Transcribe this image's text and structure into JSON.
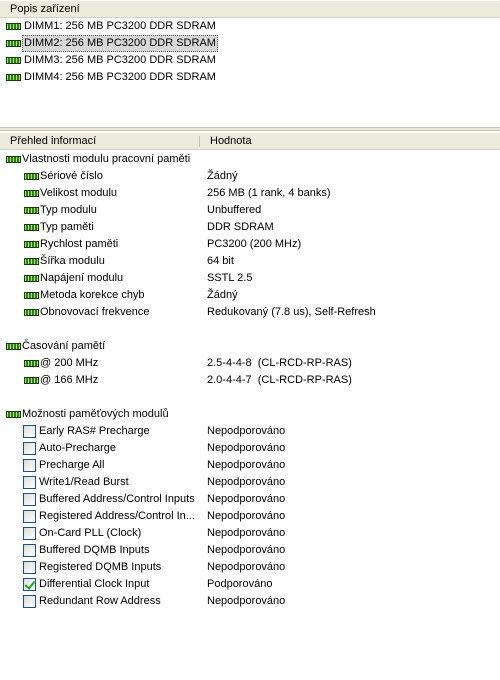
{
  "device_pane": {
    "header": "Popis zařízení",
    "items": [
      {
        "label": "DIMM1: 256 MB PC3200 DDR SDRAM",
        "selected": false
      },
      {
        "label": "DIMM2: 256 MB PC3200 DDR SDRAM",
        "selected": true
      },
      {
        "label": "DIMM3: 256 MB PC3200 DDR SDRAM",
        "selected": false
      },
      {
        "label": "DIMM4: 256 MB PC3200 DDR SDRAM",
        "selected": false
      }
    ]
  },
  "info_pane": {
    "col_field": "Přehled informací",
    "col_value": "Hodnota",
    "module_props": {
      "title": "Vlastnosti modulu pracovní paměti",
      "items": [
        {
          "name": "Sériové číslo",
          "value": "Žádný"
        },
        {
          "name": "Velikost modulu",
          "value": "256 MB (1 rank, 4 banks)"
        },
        {
          "name": "Typ modulu",
          "value": "Unbuffered"
        },
        {
          "name": "Typ paměti",
          "value": "DDR SDRAM"
        },
        {
          "name": "Rychlost paměti",
          "value": "PC3200 (200 MHz)"
        },
        {
          "name": "Šířka modulu",
          "value": "64 bit"
        },
        {
          "name": "Napájení modulu",
          "value": "SSTL 2.5"
        },
        {
          "name": "Metoda korekce chyb",
          "value": "Žádný"
        },
        {
          "name": "Obnovovací frekvence",
          "value": "Redukovaný (7.8 us), Self-Refresh"
        }
      ]
    },
    "timing": {
      "title": "Časování pamětí",
      "items": [
        {
          "name": "@ 200 MHz",
          "value": "2.5-4-4-8  (CL-RCD-RP-RAS)"
        },
        {
          "name": "@ 166 MHz",
          "value": "2.0-4-4-7  (CL-RCD-RP-RAS)"
        }
      ]
    },
    "features": {
      "title": "Možnosti paměťových modulů",
      "items": [
        {
          "name": "Early RAS# Precharge",
          "value": "Nepodporováno",
          "checked": false
        },
        {
          "name": "Auto-Precharge",
          "value": "Nepodporováno",
          "checked": false
        },
        {
          "name": "Precharge All",
          "value": "Nepodporováno",
          "checked": false
        },
        {
          "name": "Write1/Read Burst",
          "value": "Nepodporováno",
          "checked": false
        },
        {
          "name": "Buffered Address/Control Inputs",
          "value": "Nepodporováno",
          "checked": false
        },
        {
          "name": "Registered Address/Control In...",
          "value": "Nepodporováno",
          "checked": false
        },
        {
          "name": "On-Card PLL (Clock)",
          "value": "Nepodporováno",
          "checked": false
        },
        {
          "name": "Buffered DQMB Inputs",
          "value": "Nepodporováno",
          "checked": false
        },
        {
          "name": "Registered DQMB Inputs",
          "value": "Nepodporováno",
          "checked": false
        },
        {
          "name": "Differential Clock Input",
          "value": "Podporováno",
          "checked": true
        },
        {
          "name": "Redundant Row Address",
          "value": "Nepodporováno",
          "checked": false
        }
      ]
    }
  }
}
